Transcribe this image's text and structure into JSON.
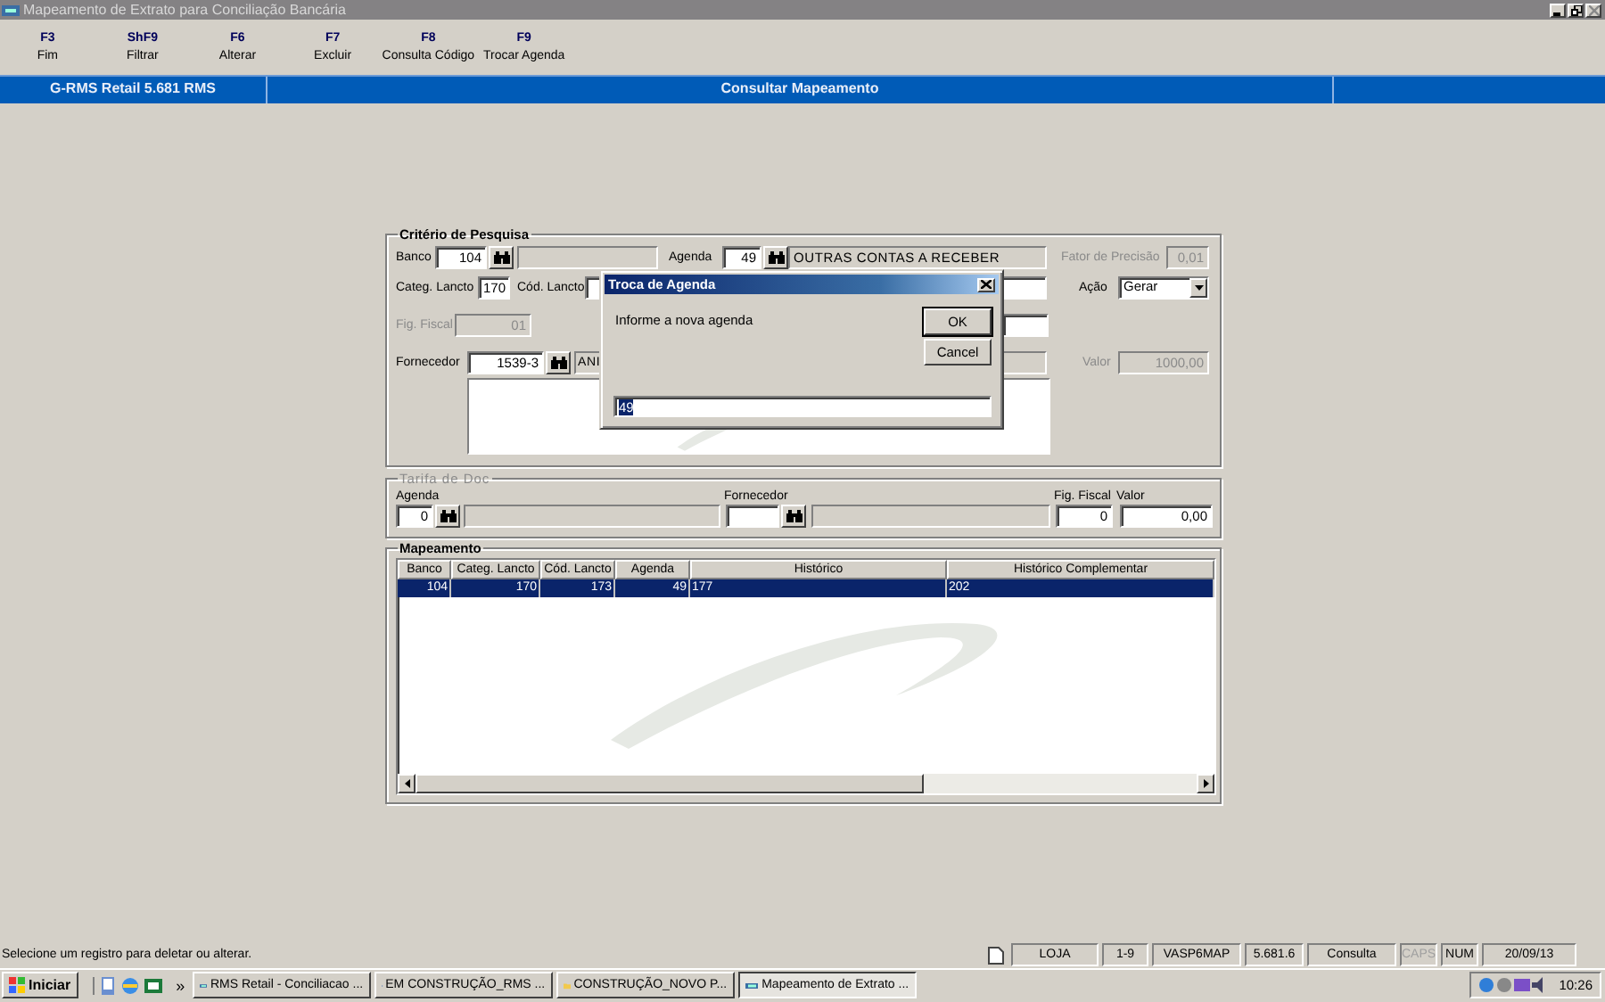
{
  "window": {
    "title": "Mapeamento de Extrato para Conciliação Bancária"
  },
  "toolbar": [
    {
      "key": "F3",
      "label": "Fim"
    },
    {
      "key": "ShF9",
      "label": "Filtrar"
    },
    {
      "key": "F6",
      "label": "Alterar"
    },
    {
      "key": "F7",
      "label": "Excluir"
    },
    {
      "key": "F8",
      "label": "Consulta Código"
    },
    {
      "key": "F9",
      "label": "Trocar Agenda"
    }
  ],
  "header": {
    "left": "G-RMS Retail 5.681 RMS",
    "title": "Consultar Mapeamento"
  },
  "criteria": {
    "title": "Critério de Pesquisa",
    "banco": {
      "label": "Banco",
      "value": "104"
    },
    "agenda": {
      "label": "Agenda",
      "value": "49",
      "description": "OUTRAS CONTAS A RECEBER"
    },
    "fator": {
      "label": "Fator de Precisão",
      "value": "0,01",
      "disabled": true
    },
    "categ": {
      "label": "Categ. Lancto",
      "value": "170"
    },
    "cod": {
      "label": "Cód. Lancto"
    },
    "acao": {
      "label": "Ação",
      "value": "Gerar"
    },
    "fig_fiscal": {
      "label": "Fig. Fiscal",
      "value": "01",
      "disabled": true
    },
    "fornecedor": {
      "label": "Fornecedor",
      "value": "1539-3",
      "description": "ANI"
    },
    "valor": {
      "label": "Valor",
      "value": "1000,00",
      "disabled": true
    }
  },
  "tarifa": {
    "title": "Tarifa de Doc",
    "disabled": true,
    "agenda": {
      "label": "Agenda",
      "value": "0"
    },
    "fornecedor": {
      "label": "Fornecedor"
    },
    "fig_fiscal": {
      "label": "Fig. Fiscal",
      "value": "0"
    },
    "valor": {
      "label": "Valor",
      "value": "0,00"
    }
  },
  "mapeamento": {
    "title": "Mapeamento",
    "columns": [
      "Banco",
      "Categ. Lancto",
      "Cód. Lancto",
      "Agenda",
      "Histórico",
      "Histórico Complementar"
    ],
    "rows": [
      {
        "cells": [
          "104",
          "170",
          "173",
          "49",
          "177",
          "202"
        ],
        "selected": true
      }
    ]
  },
  "dialog": {
    "title": "Troca de Agenda",
    "prompt": "Informe a nova agenda",
    "value": "49",
    "buttons": [
      {
        "label": "OK",
        "default": true
      },
      {
        "label": "Cancel",
        "default": false
      }
    ]
  },
  "status_bar": {
    "message": "Selecione um registro para deletar ou alterar.",
    "panels": [
      {
        "text": "LOJA",
        "disabled": false
      },
      {
        "text": "1-9",
        "disabled": false
      },
      {
        "text": "VASP6MAP",
        "disabled": false
      },
      {
        "text": "5.681.6",
        "disabled": false
      },
      {
        "text": "Consulta",
        "disabled": false
      },
      {
        "text": "CAPS",
        "disabled": true
      },
      {
        "text": "NUM",
        "disabled": false
      },
      {
        "text": "20/09/13",
        "disabled": false
      }
    ]
  },
  "taskbar": {
    "start": "Iniciar",
    "overflow": "»",
    "clock": "10:26",
    "tasks": [
      {
        "label": "RMS Retail - Conciliacao ...",
        "selected": false
      },
      {
        "label": "EM CONSTRUÇÃO_RMS ...",
        "selected": false
      },
      {
        "label": "CONSTRUÇÃO_NOVO P...",
        "selected": false
      },
      {
        "label": "Mapeamento de Extrato ...",
        "selected": true
      }
    ]
  }
}
